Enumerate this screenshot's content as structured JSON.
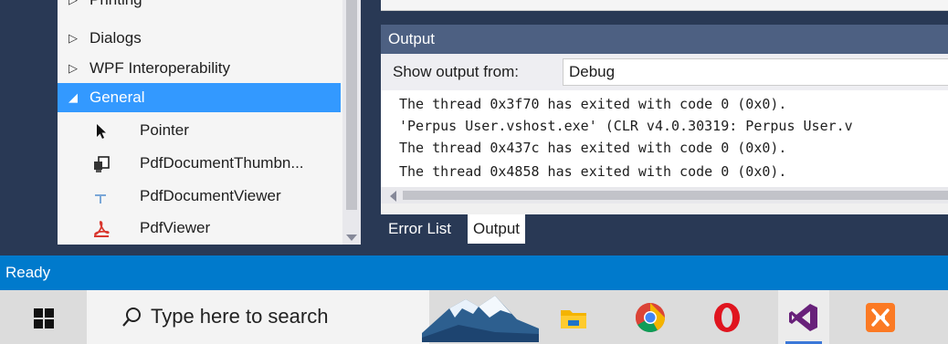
{
  "toolbox": {
    "groups": [
      {
        "label": "Printing",
        "arrow": "▷"
      },
      {
        "label": "Dialogs",
        "arrow": "▷"
      },
      {
        "label": "WPF Interoperability",
        "arrow": "▷"
      },
      {
        "label": "General",
        "arrow": "◢"
      }
    ],
    "items": [
      {
        "label": "Pointer",
        "icon": "pointer-icon"
      },
      {
        "label": "PdfDocumentThumbn...",
        "icon": "thumbnail-icon"
      },
      {
        "label": "PdfDocumentViewer",
        "icon": "document-viewer-icon"
      },
      {
        "label": "PdfViewer",
        "icon": "pdf-icon"
      }
    ]
  },
  "output": {
    "title": "Output",
    "show_from_label": "Show output from:",
    "source_value": "Debug",
    "lines": [
      "The thread 0x3f70 has exited with code 0 (0x0).",
      "'Perpus User.vshost.exe' (CLR v4.0.30319: Perpus User.v",
      "The thread 0x437c has exited with code 0 (0x0).",
      "The thread 0x4858 has exited with code 0 (0x0)."
    ],
    "tabs": [
      "Error List",
      "Output"
    ]
  },
  "statusbar": {
    "text": "Ready"
  },
  "taskbar": {
    "search_placeholder": "Type here to search",
    "apps": [
      "mountain-wallpaper-icon",
      "file-explorer-icon",
      "chrome-icon",
      "opera-icon",
      "visual-studio-icon",
      "xampp-icon"
    ]
  },
  "colors": {
    "accent": "#007acc",
    "selection": "#3399ff",
    "panel_header": "#4d6082",
    "ide_background": "#293955"
  }
}
